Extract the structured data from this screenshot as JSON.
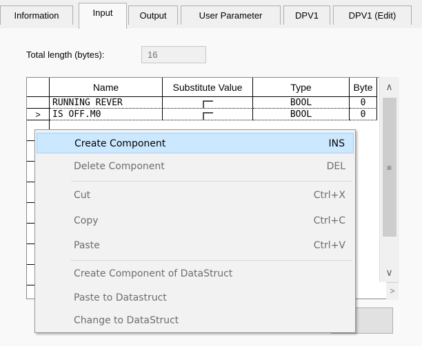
{
  "tabs": [
    {
      "label": "Information",
      "active": false
    },
    {
      "label": "Input",
      "active": true
    },
    {
      "label": "Output",
      "active": false
    },
    {
      "label": "User Parameter",
      "active": false
    },
    {
      "label": "DPV1",
      "active": false
    },
    {
      "label": "DPV1 (Edit)",
      "active": false
    }
  ],
  "total_length": {
    "label": "Total length (bytes):",
    "value": "16"
  },
  "grid": {
    "columns": [
      "Name",
      "Substitute Value",
      "Type",
      "Byte"
    ],
    "rows": [
      {
        "name": "RUNNING REVER",
        "type": "BOOL",
        "byte": "0",
        "indicator": ""
      },
      {
        "name": "IS OFF.M0",
        "type": "BOOL",
        "byte": "0",
        "indicator": ">"
      }
    ]
  },
  "scrollbar": {
    "up": "∧",
    "down": "∨",
    "grip": "≡",
    "right": ">"
  },
  "context_menu": {
    "items": [
      {
        "label": "Create Component",
        "shortcut": "INS",
        "enabled": true,
        "highlighted": true
      },
      {
        "label": "Delete Component",
        "shortcut": "DEL",
        "enabled": false
      },
      {
        "label": "Cut",
        "shortcut": "Ctrl+X",
        "enabled": false
      },
      {
        "label": "Copy",
        "shortcut": "Ctrl+C",
        "enabled": false
      },
      {
        "label": "Paste",
        "shortcut": "Ctrl+V",
        "enabled": false
      },
      {
        "label": "Create Component of DataStruct",
        "shortcut": "",
        "enabled": false
      },
      {
        "label": "Paste to Datastruct",
        "shortcut": "",
        "enabled": false
      },
      {
        "label": "Change to DataStruct",
        "shortcut": "",
        "enabled": false
      }
    ]
  }
}
